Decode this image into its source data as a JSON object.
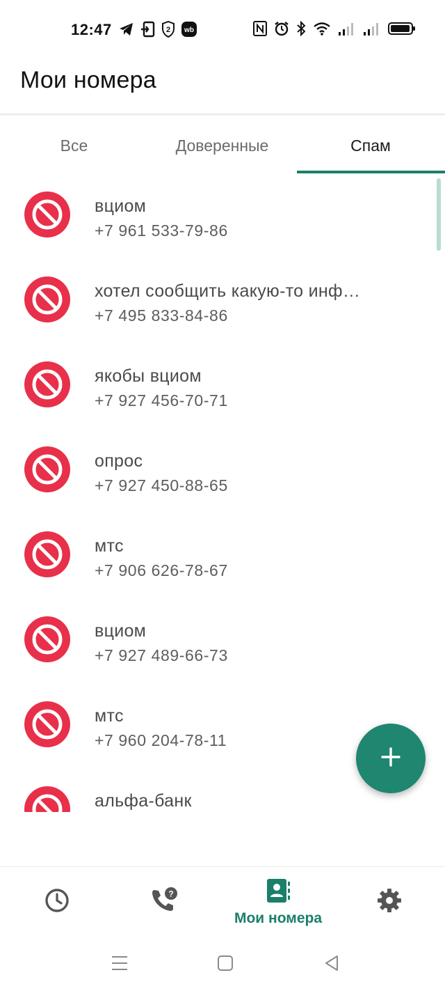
{
  "status_bar": {
    "time": "12:47",
    "left_icons": [
      "telegram-icon",
      "sim-transfer-icon",
      "two-factor-icon",
      "wb-icon"
    ],
    "right_icons": [
      "nfc-icon",
      "alarm-icon",
      "bluetooth-icon",
      "wifi-icon",
      "signal-icon",
      "signal-icon",
      "battery-icon"
    ]
  },
  "app_bar": {
    "title": "Мои номера"
  },
  "tabs": [
    {
      "label": "Все",
      "active": false
    },
    {
      "label": "Доверенные",
      "active": false
    },
    {
      "label": "Спам",
      "active": true
    }
  ],
  "list": [
    {
      "name": "вциом",
      "phone": "+7 961 533-79-86",
      "icon": "block-icon"
    },
    {
      "name": "хотел сообщить какую-то инф…",
      "phone": "+7 495 833-84-86",
      "icon": "block-icon"
    },
    {
      "name": "якобы вциом",
      "phone": "+7 927 456-70-71",
      "icon": "block-icon"
    },
    {
      "name": "опрос",
      "phone": "+7 927 450-88-65",
      "icon": "block-icon"
    },
    {
      "name": "мтс",
      "phone": "+7 906 626-78-67",
      "icon": "block-icon"
    },
    {
      "name": "вциом",
      "phone": "+7 927 489-66-73",
      "icon": "block-icon"
    },
    {
      "name": "мтс",
      "phone": "+7 960 204-78-11",
      "icon": "block-icon"
    },
    {
      "name": "альфа-банк",
      "phone": "",
      "icon": "block-icon"
    }
  ],
  "fab": {
    "icon": "plus-icon"
  },
  "bottom_nav": {
    "items": [
      {
        "icon": "history-icon",
        "label": "",
        "active": false
      },
      {
        "icon": "phone-question-icon",
        "label": "",
        "active": false
      },
      {
        "icon": "contacts-icon",
        "label": "Мои номера",
        "active": true
      },
      {
        "icon": "gear-icon",
        "label": "",
        "active": false
      }
    ]
  },
  "system_nav": [
    "menu-icon",
    "home-icon",
    "back-icon"
  ],
  "colors": {
    "accent": "#1b7f6a",
    "fab": "#1f8670",
    "block_red": "#e8304a",
    "text_primary": "#4a4a4a",
    "text_secondary": "#5d5d5d"
  }
}
